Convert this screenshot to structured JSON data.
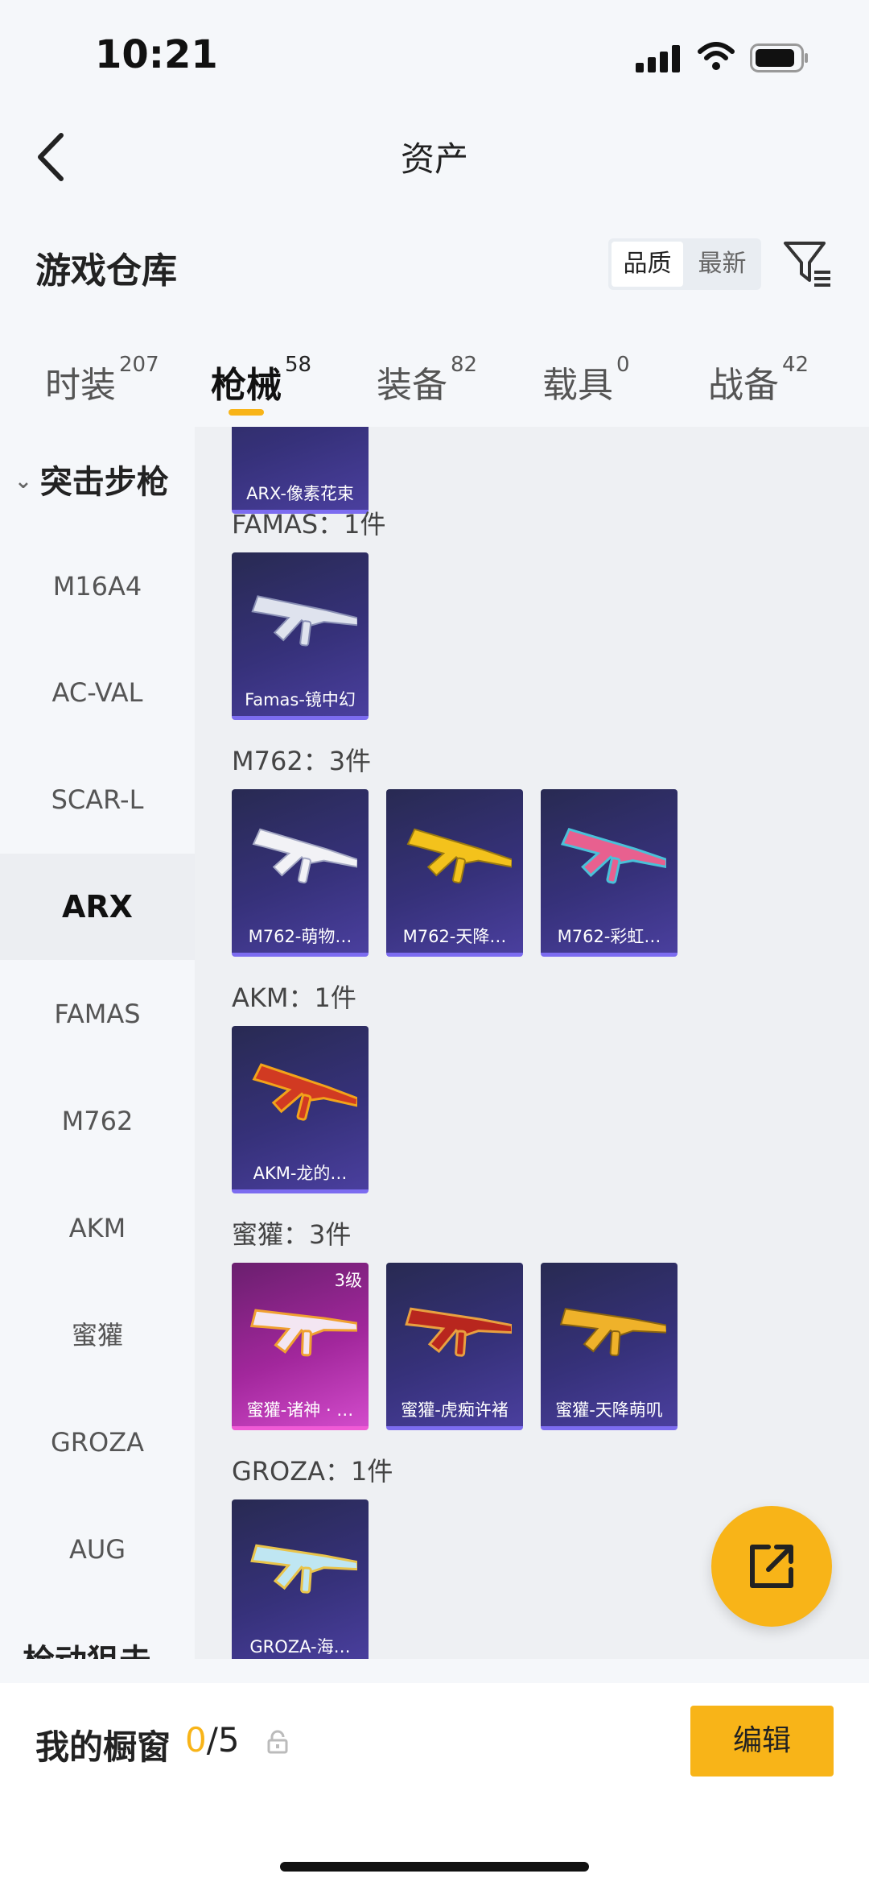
{
  "status_bar": {
    "time": "10:21"
  },
  "nav": {
    "title": "资产"
  },
  "header": {
    "title": "游戏仓库",
    "sort_options": [
      "品质",
      "最新"
    ],
    "active_sort": "品质"
  },
  "tabs": [
    {
      "label": "时装",
      "count": "207"
    },
    {
      "label": "枪械",
      "count": "58",
      "active": true
    },
    {
      "label": "装备",
      "count": "82"
    },
    {
      "label": "载具",
      "count": "0"
    },
    {
      "label": "战备",
      "count": "42"
    }
  ],
  "side": {
    "group": "突击步枪",
    "items": [
      "M16A4",
      "AC-VAL",
      "SCAR-L",
      "ARX",
      "FAMAS",
      "M762",
      "AKM",
      "蜜獾",
      "GROZA",
      "AUG"
    ],
    "active_item": "ARX",
    "next_group": "栓动狙击"
  },
  "groups": [
    {
      "title": "",
      "items": [
        {
          "name": "ARX-像素花束",
          "quality": "purple"
        }
      ]
    },
    {
      "title": "FAMAS：1件",
      "items": [
        {
          "name": "Famas-镜中幻",
          "quality": "purple"
        }
      ]
    },
    {
      "title": "M762：3件",
      "items": [
        {
          "name": "M762-萌物…",
          "quality": "purple"
        },
        {
          "name": "M762-天降…",
          "quality": "purple"
        },
        {
          "name": "M762-彩虹…",
          "quality": "purple"
        }
      ]
    },
    {
      "title": "AKM：1件",
      "items": [
        {
          "name": "AKM-龙的…",
          "quality": "purple"
        }
      ]
    },
    {
      "title": "蜜獾：3件",
      "items": [
        {
          "name": "蜜獾-诸神 · …",
          "quality": "pink",
          "level": "3级"
        },
        {
          "name": "蜜獾-虎痴许褚",
          "quality": "purple"
        },
        {
          "name": "蜜獾-天降萌叽",
          "quality": "purple"
        }
      ]
    },
    {
      "title": "GROZA：1件",
      "items": [
        {
          "name": "GROZA-海…",
          "quality": "purple"
        }
      ]
    }
  ],
  "bottom": {
    "label": "我的橱窗",
    "current": "0",
    "separator": "/5",
    "edit": "编辑"
  },
  "colors": {
    "accent": "#f8b418",
    "purple_quality": "#7c6cf0",
    "pink_quality": "#f05ad6"
  }
}
